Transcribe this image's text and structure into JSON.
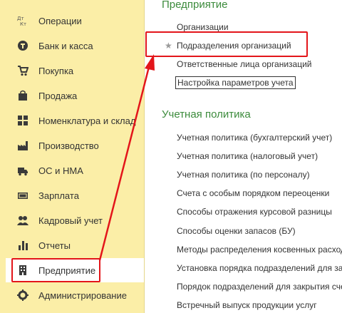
{
  "sidebar": {
    "items": [
      {
        "label": "Операции",
        "icon": "operations-icon"
      },
      {
        "label": "Банк и касса",
        "icon": "bank-icon"
      },
      {
        "label": "Покупка",
        "icon": "cart-icon"
      },
      {
        "label": "Продажа",
        "icon": "bag-icon"
      },
      {
        "label": "Номенклатура и склад",
        "icon": "grid-icon"
      },
      {
        "label": "Производство",
        "icon": "factory-icon"
      },
      {
        "label": "ОС и НМА",
        "icon": "truck-icon"
      },
      {
        "label": "Зарплата",
        "icon": "money-icon"
      },
      {
        "label": "Кадровый учет",
        "icon": "people-icon"
      },
      {
        "label": "Отчеты",
        "icon": "chart-icon"
      },
      {
        "label": "Предприятие",
        "icon": "building-icon",
        "active": true
      },
      {
        "label": "Администрирование",
        "icon": "gear-icon"
      }
    ]
  },
  "main": {
    "enterprise": {
      "title": "Предприятие",
      "links": [
        "Организации",
        "Подразделения организаций",
        "Ответственные лица организаций",
        "Настройка параметров учета"
      ]
    },
    "accounting_policy": {
      "title": "Учетная политика",
      "links": [
        "Учетная политика (бухгалтерский учет)",
        "Учетная политика (налоговый учет)",
        "Учетная политика (по персоналу)",
        "Счета с особым порядком переоценки",
        "Способы отражения курсовой разницы",
        "Способы оценки запасов (БУ)",
        "Методы распределения косвенных расходов",
        "Установка порядка подразделений для закрытия",
        "Порядок подразделений для закрытия счетов",
        "Встречный выпуск продукции услуг"
      ]
    }
  },
  "colors": {
    "sidebar_bg": "#fbeea7",
    "section_title": "#3c8b3c",
    "highlight": "#e3151a"
  }
}
